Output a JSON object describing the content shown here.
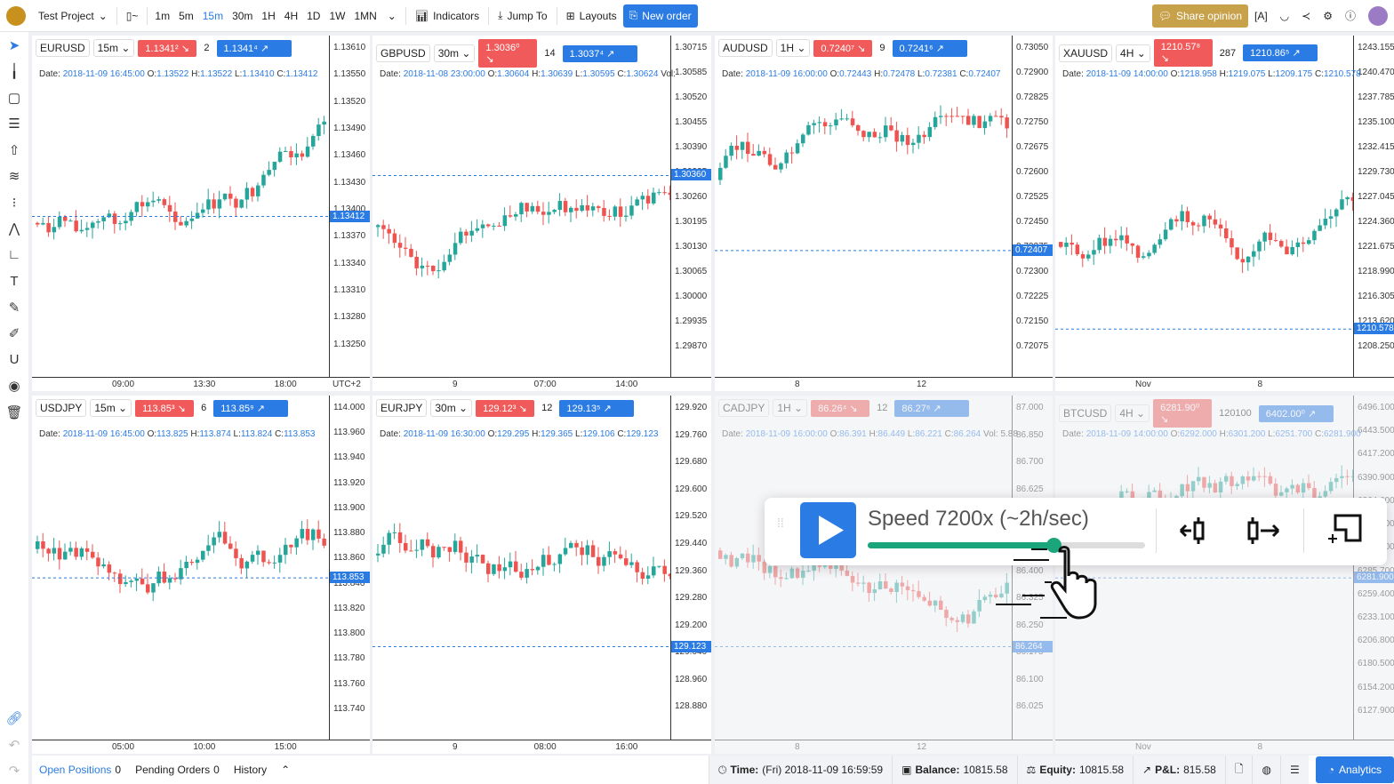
{
  "toolbar": {
    "project": "Test Project",
    "timeframes": [
      "1m",
      "5m",
      "15m",
      "30m",
      "1H",
      "4H",
      "1D",
      "1W",
      "1MN"
    ],
    "active_timeframe": "15m",
    "indicators": "Indicators",
    "jump_to": "Jump To",
    "layouts": "Layouts",
    "new_order": "New order",
    "share_opinion": "Share opinion"
  },
  "colors": {
    "accent": "#2a7be4",
    "bull": "#26a69a",
    "bear": "#ef5350",
    "gold": "#c8a14b",
    "speed": "#1aa67a"
  },
  "panels": [
    {
      "symbol": "EURUSD",
      "tf": "15m",
      "bid": "1.1341²",
      "spread": "2",
      "ask": "1.1341⁴",
      "date": "2018-11-09 16:45:00",
      "o": "1.13522",
      "h": "1.13522",
      "l": "1.13410",
      "c": "1.13412",
      "vol": "",
      "ticks": [
        "1.13610",
        "1.13550",
        "1.13520",
        "1.13490",
        "1.13460",
        "1.13430",
        "1.13400",
        "1.13370",
        "1.13340",
        "1.13310",
        "1.13280",
        "1.13250"
      ],
      "current": "1.13412",
      "times": [
        "09:00",
        "13:30",
        "18:00",
        "UTC+2"
      ]
    },
    {
      "symbol": "GBPUSD",
      "tf": "30m",
      "bid": "1.3036⁰",
      "spread": "14",
      "ask": "1.3037⁴",
      "date": "2018-11-08 23:00:00",
      "o": "1.30604",
      "h": "1.30639",
      "l": "1.30595",
      "c": "1.30624",
      "vol": "Vol:",
      "ticks": [
        "1.30715",
        "1.30585",
        "1.30520",
        "1.30455",
        "1.30390",
        "1.30325",
        "1.30260",
        "1.30195",
        "1.30130",
        "1.30065",
        "1.30000",
        "1.29935",
        "1.29870"
      ],
      "current": "1.30360",
      "times": [
        "9",
        "07:00",
        "14:00"
      ]
    },
    {
      "symbol": "AUDUSD",
      "tf": "1H",
      "bid": "0.7240⁷",
      "spread": "9",
      "ask": "0.7241⁶",
      "date": "2018-11-09 16:00:00",
      "o": "0.72443",
      "h": "0.72478",
      "l": "0.72381",
      "c": "0.72407",
      "vol": "",
      "ticks": [
        "0.73050",
        "0.72900",
        "0.72825",
        "0.72750",
        "0.72675",
        "0.72600",
        "0.72525",
        "0.72450",
        "0.72375",
        "0.72300",
        "0.72225",
        "0.72150",
        "0.72075"
      ],
      "current": "0.72407",
      "times": [
        "8",
        "12"
      ]
    },
    {
      "symbol": "XAUUSD",
      "tf": "4H",
      "bid": "1210.57⁸",
      "spread": "287",
      "ask": "1210.86⁵",
      "date": "2018-11-09 14:00:00",
      "o": "1218.958",
      "h": "1219.075",
      "l": "1209.175",
      "c": "1210.578",
      "vol": "",
      "ticks": [
        "1243.155",
        "1240.470",
        "1237.785",
        "1235.100",
        "1232.415",
        "1229.730",
        "1227.045",
        "1224.360",
        "1221.675",
        "1218.990",
        "1216.305",
        "1213.620",
        "1208.250"
      ],
      "current": "1210.578",
      "times": [
        "Nov",
        "8"
      ]
    },
    {
      "symbol": "USDJPY",
      "tf": "15m",
      "bid": "113.85³",
      "spread": "6",
      "ask": "113.85⁹",
      "date": "2018-11-09 16:45:00",
      "o": "113.825",
      "h": "113.874",
      "l": "113.824",
      "c": "113.853",
      "vol": "",
      "ticks": [
        "114.000",
        "113.960",
        "113.940",
        "113.920",
        "113.900",
        "113.880",
        "113.860",
        "113.840",
        "113.820",
        "113.800",
        "113.780",
        "113.760",
        "113.740"
      ],
      "current": "113.853",
      "times": [
        "05:00",
        "10:00",
        "15:00"
      ]
    },
    {
      "symbol": "EURJPY",
      "tf": "30m",
      "bid": "129.12³",
      "spread": "12",
      "ask": "129.13⁵",
      "date": "2018-11-09 16:30:00",
      "o": "129.295",
      "h": "129.365",
      "l": "129.106",
      "c": "129.123",
      "vol": "",
      "ticks": [
        "129.920",
        "129.760",
        "129.680",
        "129.600",
        "129.520",
        "129.440",
        "129.360",
        "129.280",
        "129.200",
        "129.040",
        "128.960",
        "128.880"
      ],
      "current": "129.123",
      "times": [
        "9",
        "08:00",
        "16:00"
      ]
    },
    {
      "symbol": "CADJPY",
      "tf": "1H",
      "bid": "86.26⁴",
      "spread": "12",
      "ask": "86.27⁶",
      "date": "2018-11-09 16:00:00",
      "o": "86.391",
      "h": "86.449",
      "l": "86.221",
      "c": "86.264",
      "vol": "Vol: 5.88",
      "ticks": [
        "87.000",
        "86.850",
        "86.700",
        "86.625",
        "86.550",
        "86.475",
        "86.400",
        "86.325",
        "86.250",
        "86.175",
        "86.100",
        "86.025"
      ],
      "current": "86.264",
      "times": [
        "8",
        "12"
      ]
    },
    {
      "symbol": "BTCUSD",
      "tf": "4H",
      "bid": "6281.90⁰",
      "spread": "120100",
      "ask": "6402.00⁰",
      "date": "2018-11-09 14:00:00",
      "o": "6292.000",
      "h": "6301.200",
      "l": "6251.700",
      "c": "6281.900",
      "vol": "",
      "ticks": [
        "6496.100",
        "6443.500",
        "6417.200",
        "6390.900",
        "6364.600",
        "6338.300",
        "6312.000",
        "6285.700",
        "6259.400",
        "6233.100",
        "6206.800",
        "6180.500",
        "6154.200",
        "6127.900"
      ],
      "current": "6281.900",
      "times": [
        "Nov",
        "8"
      ]
    }
  ],
  "labels": {
    "date": "Date:",
    "o": "O:",
    "h": "H:",
    "l": "L:",
    "c": "C:"
  },
  "speed": {
    "text": "Speed 7200x (~2h/sec)",
    "level": 0.67
  },
  "bottom": {
    "open_positions": "Open Positions",
    "open_count": "0",
    "pending": "Pending Orders",
    "pending_count": "0",
    "history": "History",
    "time_label": "Time:",
    "time": "(Fri) 2018-11-09 16:59:59",
    "balance_label": "Balance:",
    "balance": "10815.58",
    "equity_label": "Equity:",
    "equity": "10815.58",
    "pnl_label": "P&L:",
    "pnl": "815.58",
    "analytics": "Analytics"
  }
}
